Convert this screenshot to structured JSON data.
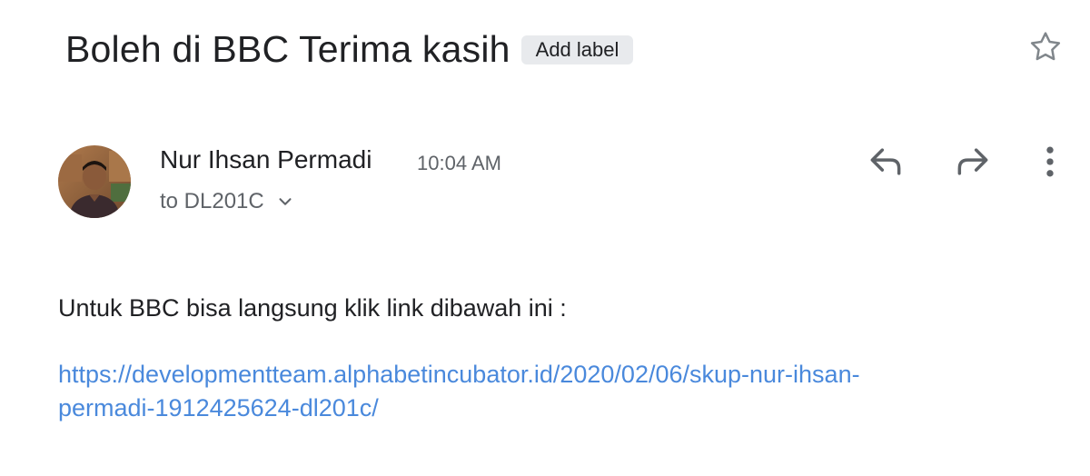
{
  "email": {
    "subject": "Boleh di BBC Terima kasih",
    "label_button": "Add label",
    "sender_name": "Nur Ihsan Permadi",
    "time": "10:04 AM",
    "recipient": "to DL201C",
    "body_line": "Untuk BBC bisa langsung klik link dibawah ini :",
    "link_line1": "https://developmentteam.alphabetincubator.id/2020/02/06/skup-nur-ihsan-",
    "link_line2": "permadi-1912425624-dl201c/"
  },
  "icons": {
    "star": "star-outline-icon",
    "reply": "reply-icon",
    "forward": "forward-icon",
    "more": "more-vert-icon",
    "expand": "chevron-down-icon"
  },
  "colors": {
    "text": "#202124",
    "secondary_text": "#5f6368",
    "link": "#4a89dc",
    "chip_bg": "#e8eaed"
  }
}
